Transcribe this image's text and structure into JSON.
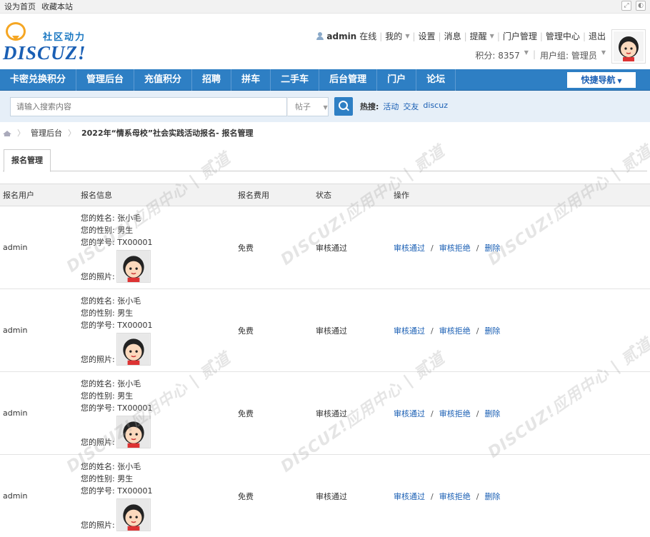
{
  "topbar": {
    "set_home": "设为首页",
    "bookmark": "收藏本站"
  },
  "logo": {
    "slogan": "社区动力",
    "word": "DISCUZ!"
  },
  "user": {
    "name": "admin",
    "status": "在线",
    "links": [
      "我的",
      "设置",
      "消息",
      "提醒",
      "门户管理",
      "管理中心",
      "退出"
    ],
    "points": "积分: 8357",
    "group": "用户组: 管理员"
  },
  "nav": {
    "items": [
      "卡密兑换积分",
      "管理后台",
      "充值积分",
      "招聘",
      "拼车",
      "二手车",
      "后台管理",
      "门户",
      "论坛"
    ],
    "quick": "快捷导航"
  },
  "search": {
    "placeholder": "请输入搜索内容",
    "type": "帖子",
    "hot_label": "热搜:",
    "hot": [
      "活动",
      "交友",
      "discuz"
    ]
  },
  "breadcrumb": {
    "items": [
      "管理后台",
      "2022年“情系母校”社会实践活动报名- 报名管理"
    ]
  },
  "tab": "报名管理",
  "table": {
    "headers": [
      "报名用户",
      "报名信息",
      "报名费用",
      "状态",
      "操作"
    ],
    "rows": [
      {
        "user": "admin",
        "name": "您的姓名: 张小毛",
        "gender": "您的性别: 男生",
        "sid": "您的学号: TX00001",
        "photo": "您的照片:",
        "fee": "免费",
        "status": "审核通过",
        "ops": [
          "审核通过",
          "审核拒绝",
          "删除"
        ]
      },
      {
        "user": "admin",
        "name": "您的姓名: 张小毛",
        "gender": "您的性别: 男生",
        "sid": "您的学号: TX00001",
        "photo": "您的照片:",
        "fee": "免费",
        "status": "审核通过",
        "ops": [
          "审核通过",
          "审核拒绝",
          "删除"
        ]
      },
      {
        "user": "admin",
        "name": "您的姓名: 张小毛",
        "gender": "您的性别: 男生",
        "sid": "您的学号: TX00001",
        "photo": "您的照片:",
        "fee": "免费",
        "status": "审核通过",
        "ops": [
          "审核通过",
          "审核拒绝",
          "删除"
        ]
      },
      {
        "user": "admin",
        "name": "您的姓名: 张小毛",
        "gender": "您的性别: 男生",
        "sid": "您的学号: TX00001",
        "photo": "您的照片:",
        "fee": "免费",
        "status": "审核通过",
        "ops": [
          "审核通过",
          "审核拒绝",
          "删除"
        ]
      }
    ]
  },
  "watermark": "DISCUZ!应用中心 | 贰道"
}
